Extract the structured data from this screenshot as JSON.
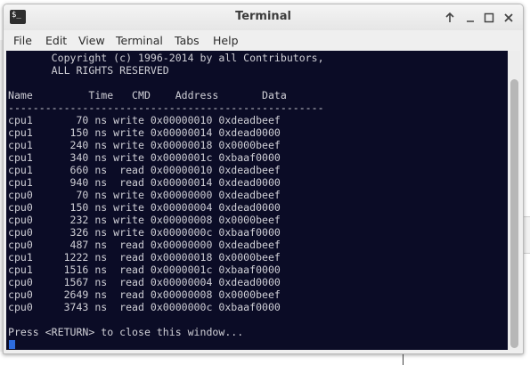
{
  "window": {
    "title": "Terminal",
    "controls": [
      "up-icon",
      "minimize-icon",
      "maximize-icon",
      "close-icon"
    ]
  },
  "menu": [
    "File",
    "Edit",
    "View",
    "Terminal",
    "Tabs",
    "Help"
  ],
  "terminal": {
    "header_lines": [
      "       Copyright (c) 1996-2014 by all Contributors,",
      "       ALL RIGHTS RESERVED"
    ],
    "columns": [
      "Name",
      "Time",
      "CMD",
      "Address",
      "Data"
    ],
    "separator": "---------------------------------------------------",
    "rows": [
      {
        "name": "cpu1",
        "time": "70",
        "unit": "ns",
        "cmd": "write",
        "address": "0x00000010",
        "data": "0xdeadbeef"
      },
      {
        "name": "cpu1",
        "time": "150",
        "unit": "ns",
        "cmd": "write",
        "address": "0x00000014",
        "data": "0xdead0000"
      },
      {
        "name": "cpu1",
        "time": "240",
        "unit": "ns",
        "cmd": "write",
        "address": "0x00000018",
        "data": "0x0000beef"
      },
      {
        "name": "cpu1",
        "time": "340",
        "unit": "ns",
        "cmd": "write",
        "address": "0x0000001c",
        "data": "0xbaaf0000"
      },
      {
        "name": "cpu1",
        "time": "660",
        "unit": "ns",
        "cmd": "read",
        "address": "0x00000010",
        "data": "0xdeadbeef"
      },
      {
        "name": "cpu1",
        "time": "940",
        "unit": "ns",
        "cmd": "read",
        "address": "0x00000014",
        "data": "0xdead0000"
      },
      {
        "name": "cpu0",
        "time": "70",
        "unit": "ns",
        "cmd": "write",
        "address": "0x00000000",
        "data": "0xdeadbeef"
      },
      {
        "name": "cpu0",
        "time": "150",
        "unit": "ns",
        "cmd": "write",
        "address": "0x00000004",
        "data": "0xdead0000"
      },
      {
        "name": "cpu0",
        "time": "232",
        "unit": "ns",
        "cmd": "write",
        "address": "0x00000008",
        "data": "0x0000beef"
      },
      {
        "name": "cpu0",
        "time": "326",
        "unit": "ns",
        "cmd": "write",
        "address": "0x0000000c",
        "data": "0xbaaf0000"
      },
      {
        "name": "cpu0",
        "time": "487",
        "unit": "ns",
        "cmd": "read",
        "address": "0x00000000",
        "data": "0xdeadbeef"
      },
      {
        "name": "cpu1",
        "time": "1222",
        "unit": "ns",
        "cmd": "read",
        "address": "0x00000018",
        "data": "0x0000beef"
      },
      {
        "name": "cpu1",
        "time": "1516",
        "unit": "ns",
        "cmd": "read",
        "address": "0x0000001c",
        "data": "0xbaaf0000"
      },
      {
        "name": "cpu0",
        "time": "1567",
        "unit": "ns",
        "cmd": "read",
        "address": "0x00000004",
        "data": "0xdead0000"
      },
      {
        "name": "cpu0",
        "time": "2649",
        "unit": "ns",
        "cmd": "read",
        "address": "0x00000008",
        "data": "0x0000beef"
      },
      {
        "name": "cpu0",
        "time": "3743",
        "unit": "ns",
        "cmd": "read",
        "address": "0x0000000c",
        "data": "0xbaaf0000"
      }
    ],
    "prompt": "Press <RETURN> to close this window..."
  },
  "colors": {
    "terminal_bg": "#0b0c26",
    "terminal_fg": "#cfcfd6",
    "cursor": "#2d6cdf"
  }
}
